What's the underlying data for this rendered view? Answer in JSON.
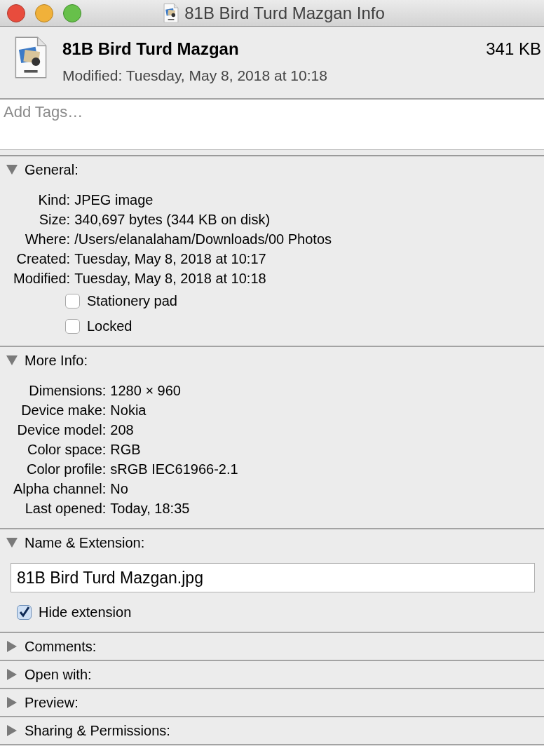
{
  "window": {
    "title": "81B Bird Turd Mazgan Info"
  },
  "header": {
    "name": "81B Bird Turd Mazgan",
    "size": "341 KB",
    "modified": "Modified: Tuesday, May 8, 2018 at 10:18"
  },
  "tags": {
    "placeholder": "Add Tags…"
  },
  "sections": [
    {
      "title": "General:",
      "expanded": true,
      "rows": [
        {
          "label": "Kind:",
          "value": "JPEG image"
        },
        {
          "label": "Size:",
          "value": "340,697 bytes (344 KB on disk)"
        },
        {
          "label": "Where:",
          "value": "/Users/elanalaham/Downloads/00 Photos"
        },
        {
          "label": "Created:",
          "value": "Tuesday, May 8, 2018 at 10:17"
        },
        {
          "label": "Modified:",
          "value": "Tuesday, May 8, 2018 at 10:18"
        }
      ],
      "checkboxes": [
        {
          "label": "Stationery pad",
          "checked": false
        },
        {
          "label": "Locked",
          "checked": false
        }
      ]
    },
    {
      "title": "More Info:",
      "expanded": true,
      "rows": [
        {
          "label": "Dimensions:",
          "value": "1280 × 960"
        },
        {
          "label": "Device make:",
          "value": "Nokia"
        },
        {
          "label": "Device model:",
          "value": "208"
        },
        {
          "label": "Color space:",
          "value": "RGB"
        },
        {
          "label": "Color profile:",
          "value": "sRGB IEC61966-2.1"
        },
        {
          "label": "Alpha channel:",
          "value": "No"
        },
        {
          "label": "Last opened:",
          "value": "Today, 18:35"
        }
      ]
    },
    {
      "title": "Name & Extension:",
      "expanded": true,
      "name_field": {
        "value": "81B Bird Turd Mazgan.jpg"
      },
      "checkboxes": [
        {
          "label": "Hide extension",
          "checked": true
        }
      ]
    },
    {
      "title": "Comments:",
      "expanded": false
    },
    {
      "title": "Open with:",
      "expanded": false
    },
    {
      "title": "Preview:",
      "expanded": false
    },
    {
      "title": "Sharing & Permissions:",
      "expanded": false
    }
  ]
}
